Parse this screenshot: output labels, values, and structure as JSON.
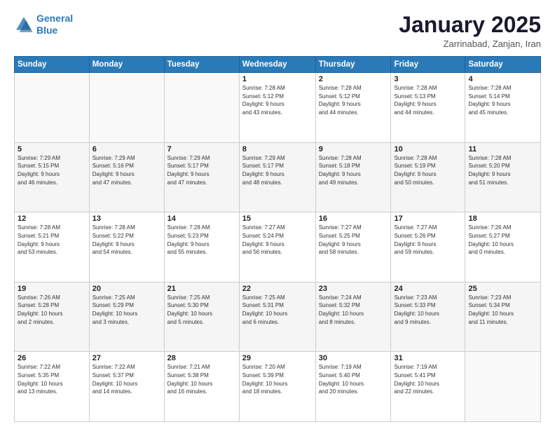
{
  "logo": {
    "line1": "General",
    "line2": "Blue"
  },
  "title": "January 2025",
  "subtitle": "Zarrinabad, Zanjan, Iran",
  "weekdays": [
    "Sunday",
    "Monday",
    "Tuesday",
    "Wednesday",
    "Thursday",
    "Friday",
    "Saturday"
  ],
  "weeks": [
    [
      {
        "day": "",
        "info": ""
      },
      {
        "day": "",
        "info": ""
      },
      {
        "day": "",
        "info": ""
      },
      {
        "day": "1",
        "info": "Sunrise: 7:28 AM\nSunset: 5:12 PM\nDaylight: 9 hours\nand 43 minutes."
      },
      {
        "day": "2",
        "info": "Sunrise: 7:28 AM\nSunset: 5:12 PM\nDaylight: 9 hours\nand 44 minutes."
      },
      {
        "day": "3",
        "info": "Sunrise: 7:28 AM\nSunset: 5:13 PM\nDaylight: 9 hours\nand 44 minutes."
      },
      {
        "day": "4",
        "info": "Sunrise: 7:28 AM\nSunset: 5:14 PM\nDaylight: 9 hours\nand 45 minutes."
      }
    ],
    [
      {
        "day": "5",
        "info": "Sunrise: 7:29 AM\nSunset: 5:15 PM\nDaylight: 9 hours\nand 46 minutes."
      },
      {
        "day": "6",
        "info": "Sunrise: 7:29 AM\nSunset: 5:16 PM\nDaylight: 9 hours\nand 47 minutes."
      },
      {
        "day": "7",
        "info": "Sunrise: 7:29 AM\nSunset: 5:17 PM\nDaylight: 9 hours\nand 47 minutes."
      },
      {
        "day": "8",
        "info": "Sunrise: 7:29 AM\nSunset: 5:17 PM\nDaylight: 9 hours\nand 48 minutes."
      },
      {
        "day": "9",
        "info": "Sunrise: 7:28 AM\nSunset: 5:18 PM\nDaylight: 9 hours\nand 49 minutes."
      },
      {
        "day": "10",
        "info": "Sunrise: 7:28 AM\nSunset: 5:19 PM\nDaylight: 9 hours\nand 50 minutes."
      },
      {
        "day": "11",
        "info": "Sunrise: 7:28 AM\nSunset: 5:20 PM\nDaylight: 9 hours\nand 51 minutes."
      }
    ],
    [
      {
        "day": "12",
        "info": "Sunrise: 7:28 AM\nSunset: 5:21 PM\nDaylight: 9 hours\nand 53 minutes."
      },
      {
        "day": "13",
        "info": "Sunrise: 7:28 AM\nSunset: 5:22 PM\nDaylight: 9 hours\nand 54 minutes."
      },
      {
        "day": "14",
        "info": "Sunrise: 7:28 AM\nSunset: 5:23 PM\nDaylight: 9 hours\nand 55 minutes."
      },
      {
        "day": "15",
        "info": "Sunrise: 7:27 AM\nSunset: 5:24 PM\nDaylight: 9 hours\nand 56 minutes."
      },
      {
        "day": "16",
        "info": "Sunrise: 7:27 AM\nSunset: 5:25 PM\nDaylight: 9 hours\nand 58 minutes."
      },
      {
        "day": "17",
        "info": "Sunrise: 7:27 AM\nSunset: 5:26 PM\nDaylight: 9 hours\nand 59 minutes."
      },
      {
        "day": "18",
        "info": "Sunrise: 7:26 AM\nSunset: 5:27 PM\nDaylight: 10 hours\nand 0 minutes."
      }
    ],
    [
      {
        "day": "19",
        "info": "Sunrise: 7:26 AM\nSunset: 5:28 PM\nDaylight: 10 hours\nand 2 minutes."
      },
      {
        "day": "20",
        "info": "Sunrise: 7:25 AM\nSunset: 5:29 PM\nDaylight: 10 hours\nand 3 minutes."
      },
      {
        "day": "21",
        "info": "Sunrise: 7:25 AM\nSunset: 5:30 PM\nDaylight: 10 hours\nand 5 minutes."
      },
      {
        "day": "22",
        "info": "Sunrise: 7:25 AM\nSunset: 5:31 PM\nDaylight: 10 hours\nand 6 minutes."
      },
      {
        "day": "23",
        "info": "Sunrise: 7:24 AM\nSunset: 5:32 PM\nDaylight: 10 hours\nand 8 minutes."
      },
      {
        "day": "24",
        "info": "Sunrise: 7:23 AM\nSunset: 5:33 PM\nDaylight: 10 hours\nand 9 minutes."
      },
      {
        "day": "25",
        "info": "Sunrise: 7:23 AM\nSunset: 5:34 PM\nDaylight: 10 hours\nand 11 minutes."
      }
    ],
    [
      {
        "day": "26",
        "info": "Sunrise: 7:22 AM\nSunset: 5:35 PM\nDaylight: 10 hours\nand 13 minutes."
      },
      {
        "day": "27",
        "info": "Sunrise: 7:22 AM\nSunset: 5:37 PM\nDaylight: 10 hours\nand 14 minutes."
      },
      {
        "day": "28",
        "info": "Sunrise: 7:21 AM\nSunset: 5:38 PM\nDaylight: 10 hours\nand 16 minutes."
      },
      {
        "day": "29",
        "info": "Sunrise: 7:20 AM\nSunset: 5:39 PM\nDaylight: 10 hours\nand 18 minutes."
      },
      {
        "day": "30",
        "info": "Sunrise: 7:19 AM\nSunset: 5:40 PM\nDaylight: 10 hours\nand 20 minutes."
      },
      {
        "day": "31",
        "info": "Sunrise: 7:19 AM\nSunset: 5:41 PM\nDaylight: 10 hours\nand 22 minutes."
      },
      {
        "day": "",
        "info": ""
      }
    ]
  ]
}
